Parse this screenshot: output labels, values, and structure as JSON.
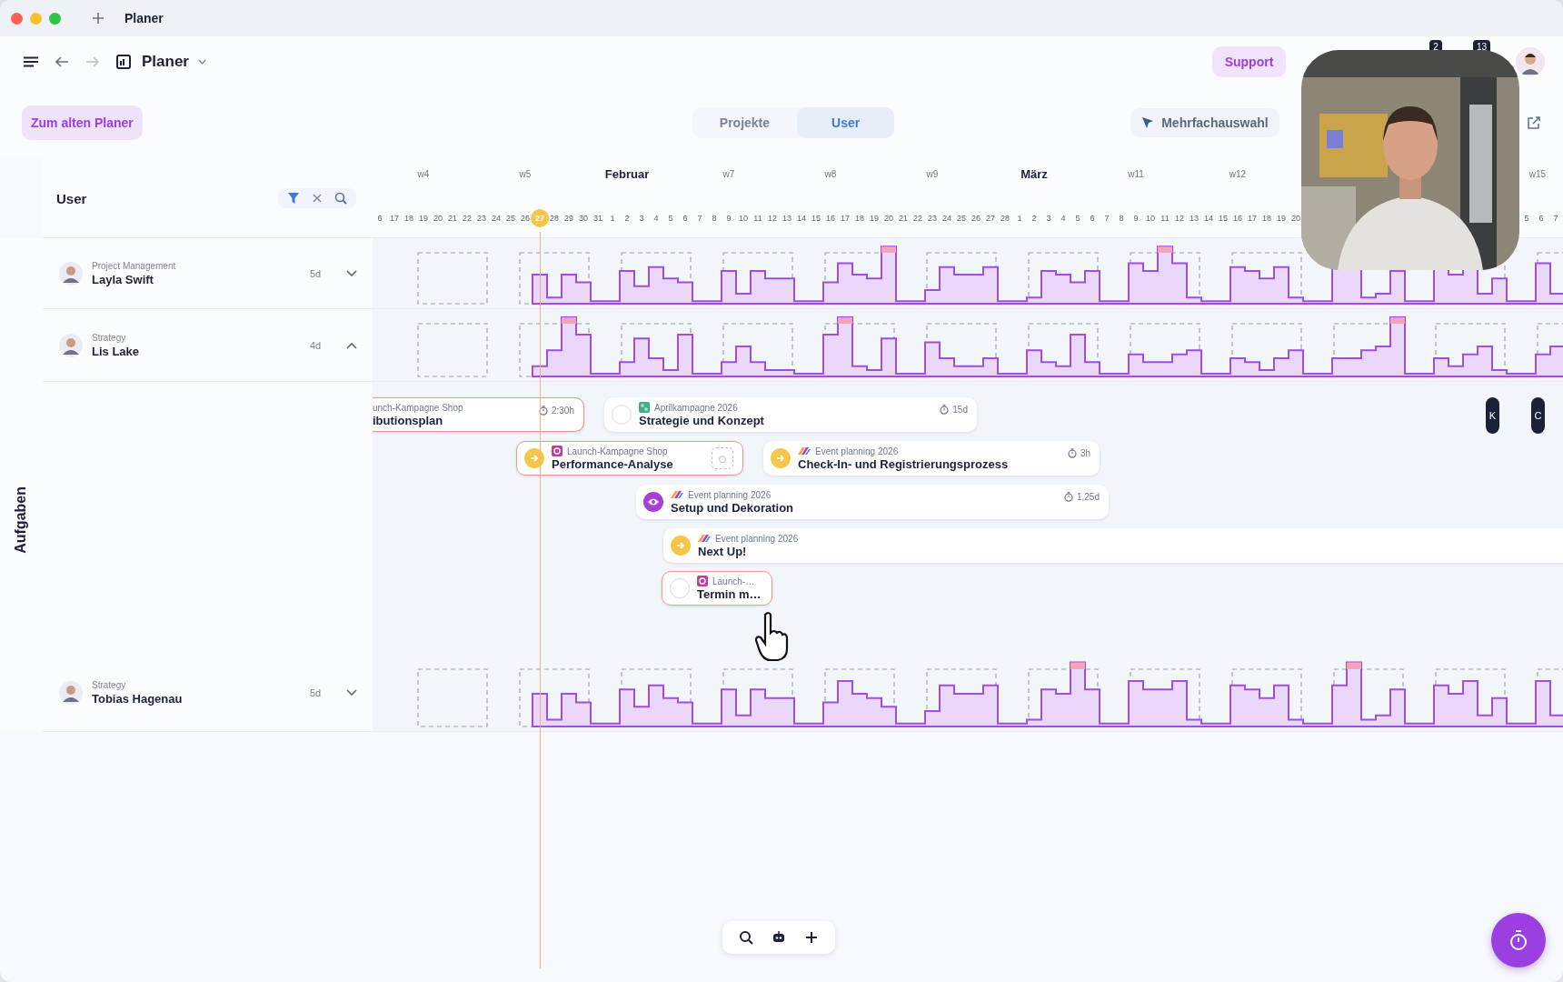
{
  "window": {
    "title": "Planer"
  },
  "toolbar": {
    "title": "Planer",
    "support": "Support",
    "badges": [
      {
        "count": "2"
      },
      {
        "count": "13"
      }
    ]
  },
  "legacy_button": "Zum alten Planer",
  "view_tabs": [
    {
      "label": "Projekte",
      "selected": false
    },
    {
      "label": "User",
      "selected": true
    }
  ],
  "multi_select": "Mehrfachauswahl",
  "timeline": {
    "panel_title": "User",
    "filter_active": true,
    "periods": [
      {
        "label": "w4",
        "kind": "week"
      },
      {
        "label": "w5",
        "kind": "week"
      },
      {
        "label": "Februar",
        "kind": "month"
      },
      {
        "label": "w7",
        "kind": "week"
      },
      {
        "label": "w8",
        "kind": "week"
      },
      {
        "label": "w9",
        "kind": "week"
      },
      {
        "label": "März",
        "kind": "month"
      },
      {
        "label": "w11",
        "kind": "week"
      },
      {
        "label": "w12",
        "kind": "week"
      }
    ],
    "periods_end": [
      {
        "label": "w15",
        "kind": "week"
      }
    ],
    "days_before": [
      "6",
      "17",
      "18",
      "19",
      "20",
      "21",
      "22",
      "23",
      "24",
      "25",
      "26"
    ],
    "today": "27",
    "days_after": [
      "28",
      "29",
      "30",
      "31",
      "1",
      "2",
      "3",
      "4",
      "5",
      "6",
      "7",
      "8",
      "9",
      "10",
      "11",
      "12",
      "13",
      "14",
      "15",
      "16",
      "17",
      "18",
      "19",
      "20",
      "21",
      "22",
      "23",
      "24",
      "25",
      "26",
      "27",
      "28",
      "1",
      "2",
      "3",
      "4",
      "5",
      "6",
      "7",
      "8",
      "9",
      "10",
      "11",
      "12",
      "13",
      "14",
      "15",
      "16",
      "17",
      "18",
      "19",
      "20"
    ],
    "days_end": [
      "5",
      "6",
      "7"
    ]
  },
  "users": [
    {
      "role": "Project Management",
      "name": "Layla Swift",
      "capacity": "5d",
      "expanded": false
    },
    {
      "role": "Strategy",
      "name": "Lis Lake",
      "capacity": "4d",
      "expanded": true,
      "tasks": [
        {
          "project": "unch-Kampagne Shop",
          "title": "ibutionsplan",
          "duration": "2:30h",
          "overdue": true,
          "timer_slot": false
        },
        {
          "project": "Aprilkampagne 2026",
          "title": "Strategie und Konzept",
          "duration": "15d",
          "status": {
            "kind": "open"
          },
          "project_icon": {
            "kind": "april"
          },
          "overdue": false,
          "timer_slot": false
        },
        {
          "project": "Launch-Kampagne Shop",
          "title": "Performance-Analyse",
          "status": {
            "kind": "next"
          },
          "project_icon": {
            "kind": "launch"
          },
          "overdue": true,
          "timer_slot": true
        },
        {
          "project": "Event planning 2026",
          "title": "Check-In- und Registrierungsprozess",
          "duration": "3h",
          "status": {
            "kind": "next"
          },
          "project_icon": {
            "kind": "event"
          },
          "overdue": false,
          "timer_slot": false
        },
        {
          "project": "Event planning 2026",
          "title": "Setup und Dekoration",
          "duration": "1,25d",
          "status": {
            "kind": "review"
          },
          "project_icon": {
            "kind": "event"
          },
          "overdue": false,
          "timer_slot": false
        },
        {
          "project": "Event planning 2026",
          "title": "Next Up!",
          "status": {
            "kind": "next"
          },
          "project_icon": {
            "kind": "event"
          },
          "overdue": false,
          "timer_slot": false
        },
        {
          "project": "Launch-…",
          "title": "Termin m…",
          "status": {
            "kind": "open"
          },
          "project_icon": {
            "kind": "launch"
          },
          "overdue": true,
          "timer_slot": false
        }
      ]
    },
    {
      "role": "Strategy",
      "name": "Tobias Hagenau",
      "capacity": "5d",
      "expanded": false
    }
  ],
  "collapsed_items": [
    {
      "label": "K"
    },
    {
      "label": "C"
    }
  ],
  "side_label": "Aufgaben"
}
